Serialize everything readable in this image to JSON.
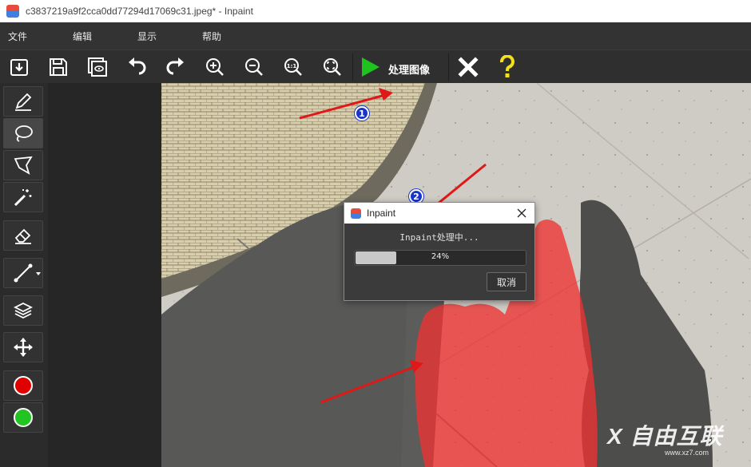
{
  "window": {
    "title": "c3837219a9f2cca0dd77294d17069c31.jpeg* - Inpaint"
  },
  "menu": {
    "items": [
      "文件",
      "编辑",
      "显示",
      "帮助"
    ]
  },
  "toolbar": {
    "process_label": "处理图像",
    "icons": [
      "open-file-icon",
      "save-icon",
      "save-as-icon",
      "undo-icon",
      "redo-icon",
      "zoom-in-icon",
      "zoom-out-icon",
      "zoom-actual-icon",
      "zoom-fit-icon",
      "play-icon",
      "close-icon",
      "help-icon"
    ]
  },
  "tools": [
    "pencil-icon",
    "lasso-icon",
    "polygon-lasso-icon",
    "magic-wand-icon",
    "eraser-icon",
    "line-icon",
    "layers-icon",
    "move-icon"
  ],
  "colors": {
    "primary": "#e00000",
    "secondary": "#22c422",
    "play_green": "#1ec41e",
    "help_yellow": "#f2e11a",
    "mask_red": "#ee3b3b"
  },
  "dialog": {
    "title": "Inpaint",
    "status": "Inpaint处理中...",
    "progress_value": 0.24,
    "progress_text": "24%",
    "cancel_label": "取消"
  },
  "annotations": {
    "badge1": "1",
    "badge2": "2"
  },
  "watermark": {
    "brand": "X 自由互联",
    "url": "www.xz7.com"
  }
}
